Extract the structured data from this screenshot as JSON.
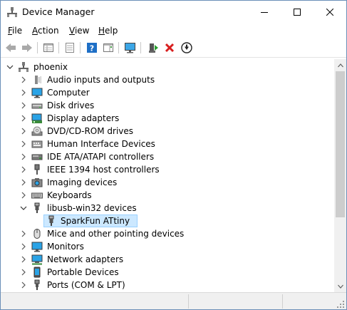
{
  "window": {
    "title": "Device Manager"
  },
  "window_controls": {
    "minimize": "—",
    "maximize": "☐",
    "close": "✕"
  },
  "menu": {
    "items": [
      {
        "label": "File",
        "key": "F",
        "rest": "ile"
      },
      {
        "label": "Action",
        "key": "A",
        "rest": "ction"
      },
      {
        "label": "View",
        "key": "V",
        "rest": "iew"
      },
      {
        "label": "Help",
        "key": "H",
        "rest": "elp"
      }
    ]
  },
  "toolbar": {
    "buttons": [
      "back-icon",
      "forward-icon",
      "properties-list-icon",
      "properties-icon",
      "help-icon",
      "action-pane-icon",
      "monitor-scan-icon",
      "update-driver-icon",
      "uninstall-icon",
      "disable-icon"
    ]
  },
  "tree": {
    "root": "phoenix",
    "rows": [
      {
        "label": "Audio inputs and outputs",
        "icon": "speaker-icon",
        "state": "collapsed"
      },
      {
        "label": "Computer",
        "icon": "computer-icon",
        "state": "collapsed"
      },
      {
        "label": "Disk drives",
        "icon": "disk-drive-icon",
        "state": "collapsed"
      },
      {
        "label": "Display adapters",
        "icon": "display-adapter-icon",
        "state": "collapsed"
      },
      {
        "label": "DVD/CD-ROM drives",
        "icon": "dvd-drive-icon",
        "state": "collapsed"
      },
      {
        "label": "Human Interface Devices",
        "icon": "hid-icon",
        "state": "collapsed"
      },
      {
        "label": "IDE ATA/ATAPI controllers",
        "icon": "ide-controller-icon",
        "state": "collapsed"
      },
      {
        "label": "IEEE 1394 host controllers",
        "icon": "ieee1394-icon",
        "state": "collapsed"
      },
      {
        "label": "Imaging devices",
        "icon": "camera-icon",
        "state": "collapsed"
      },
      {
        "label": "Keyboards",
        "icon": "keyboard-icon",
        "state": "collapsed"
      },
      {
        "label": "libusb-win32 devices",
        "icon": "usb-plug-icon",
        "state": "expanded"
      },
      {
        "label": "SparkFun ATtiny",
        "icon": "usb-plug-icon",
        "state": "child-selected"
      },
      {
        "label": "Mice and other pointing devices",
        "icon": "mouse-icon",
        "state": "collapsed"
      },
      {
        "label": "Monitors",
        "icon": "monitor-icon",
        "state": "collapsed"
      },
      {
        "label": "Network adapters",
        "icon": "network-adapter-icon",
        "state": "collapsed"
      },
      {
        "label": "Portable Devices",
        "icon": "portable-device-icon",
        "state": "collapsed"
      },
      {
        "label": "Ports (COM & LPT)",
        "icon": "port-icon",
        "state": "collapsed"
      }
    ]
  },
  "colors": {
    "selection_bg": "#cce8ff",
    "selection_border": "#99d1ff",
    "uninstall_red": "#d81e1e",
    "accent_blue": "#1e6fc6",
    "monitor_blue": "#2aa3e6"
  }
}
